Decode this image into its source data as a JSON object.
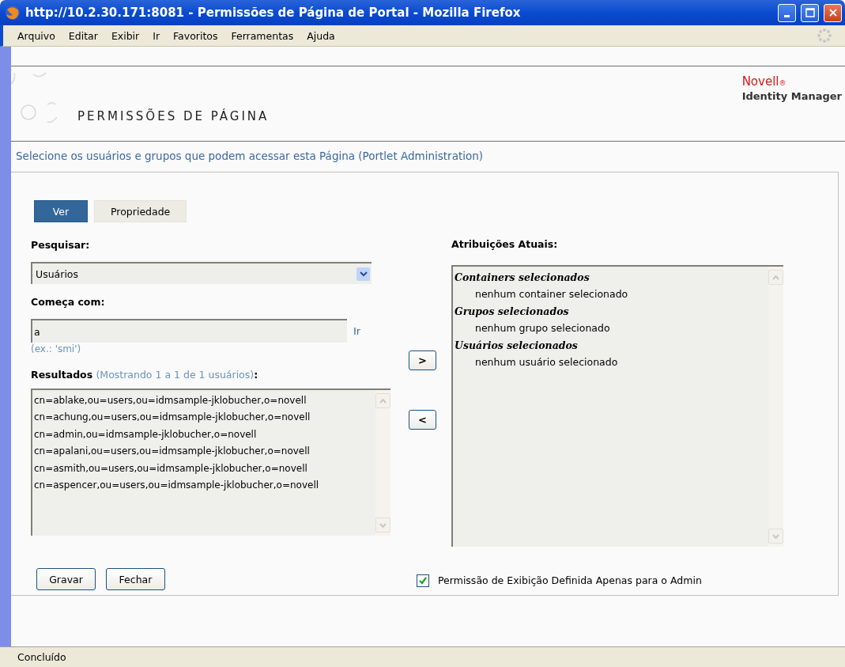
{
  "window": {
    "title": "http://10.2.30.171:8081 - Permissões de Página de Portal - Mozilla Firefox"
  },
  "menu": [
    "Arquivo",
    "Editar",
    "Exibir",
    "Ir",
    "Favoritos",
    "Ferramentas",
    "Ajuda"
  ],
  "header": {
    "title": "PERMISSÕES DE PÁGINA",
    "brand": "Novell",
    "brand_mark": "®",
    "product": "Identity Manager"
  },
  "intro": "Selecione os usuários e grupos que podem acessar esta Página (Portlet Administration)",
  "tabs": [
    {
      "label": "Ver",
      "selected": true
    },
    {
      "label": "Propriedade",
      "selected": false
    }
  ],
  "search": {
    "label": "Pesquisar:",
    "value": "Usuários"
  },
  "starts_with": {
    "label": "Começa com:",
    "value": "a",
    "go": "Ir",
    "hint": "(ex.: 'smi')"
  },
  "results": {
    "label": "Resultados",
    "summary": "(Mostrando 1 a 1 de 1 usuários)",
    "suffix": ":",
    "items": [
      "cn=ablake,ou=users,ou=idmsample-jklobucher,o=novell",
      "cn=achung,ou=users,ou=idmsample-jklobucher,o=novell",
      "cn=admin,ou=idmsample-jklobucher,o=novell",
      "cn=apalani,ou=users,ou=idmsample-jklobucher,o=novell",
      "cn=asmith,ou=users,ou=idmsample-jklobucher,o=novell",
      "cn=aspencer,ou=users,ou=idmsample-jklobucher,o=novell"
    ]
  },
  "move_buttons": [
    ">",
    "<"
  ],
  "assignments": {
    "label": "Atribuições Atuais:",
    "groups": [
      {
        "heading": "Containers selecionados",
        "items": [
          "nenhum container selecionado"
        ]
      },
      {
        "heading": "Grupos selecionados",
        "items": [
          "nenhum grupo selecionado"
        ]
      },
      {
        "heading": "Usuários selecionados",
        "items": [
          "nenhum usuário selecionado"
        ]
      }
    ]
  },
  "actions": [
    "Gravar",
    "Fechar"
  ],
  "admin_only": {
    "label": "Permissão de Exibição Definida Apenas para o Admin",
    "checked": true
  },
  "status_bar": "Concluído"
}
